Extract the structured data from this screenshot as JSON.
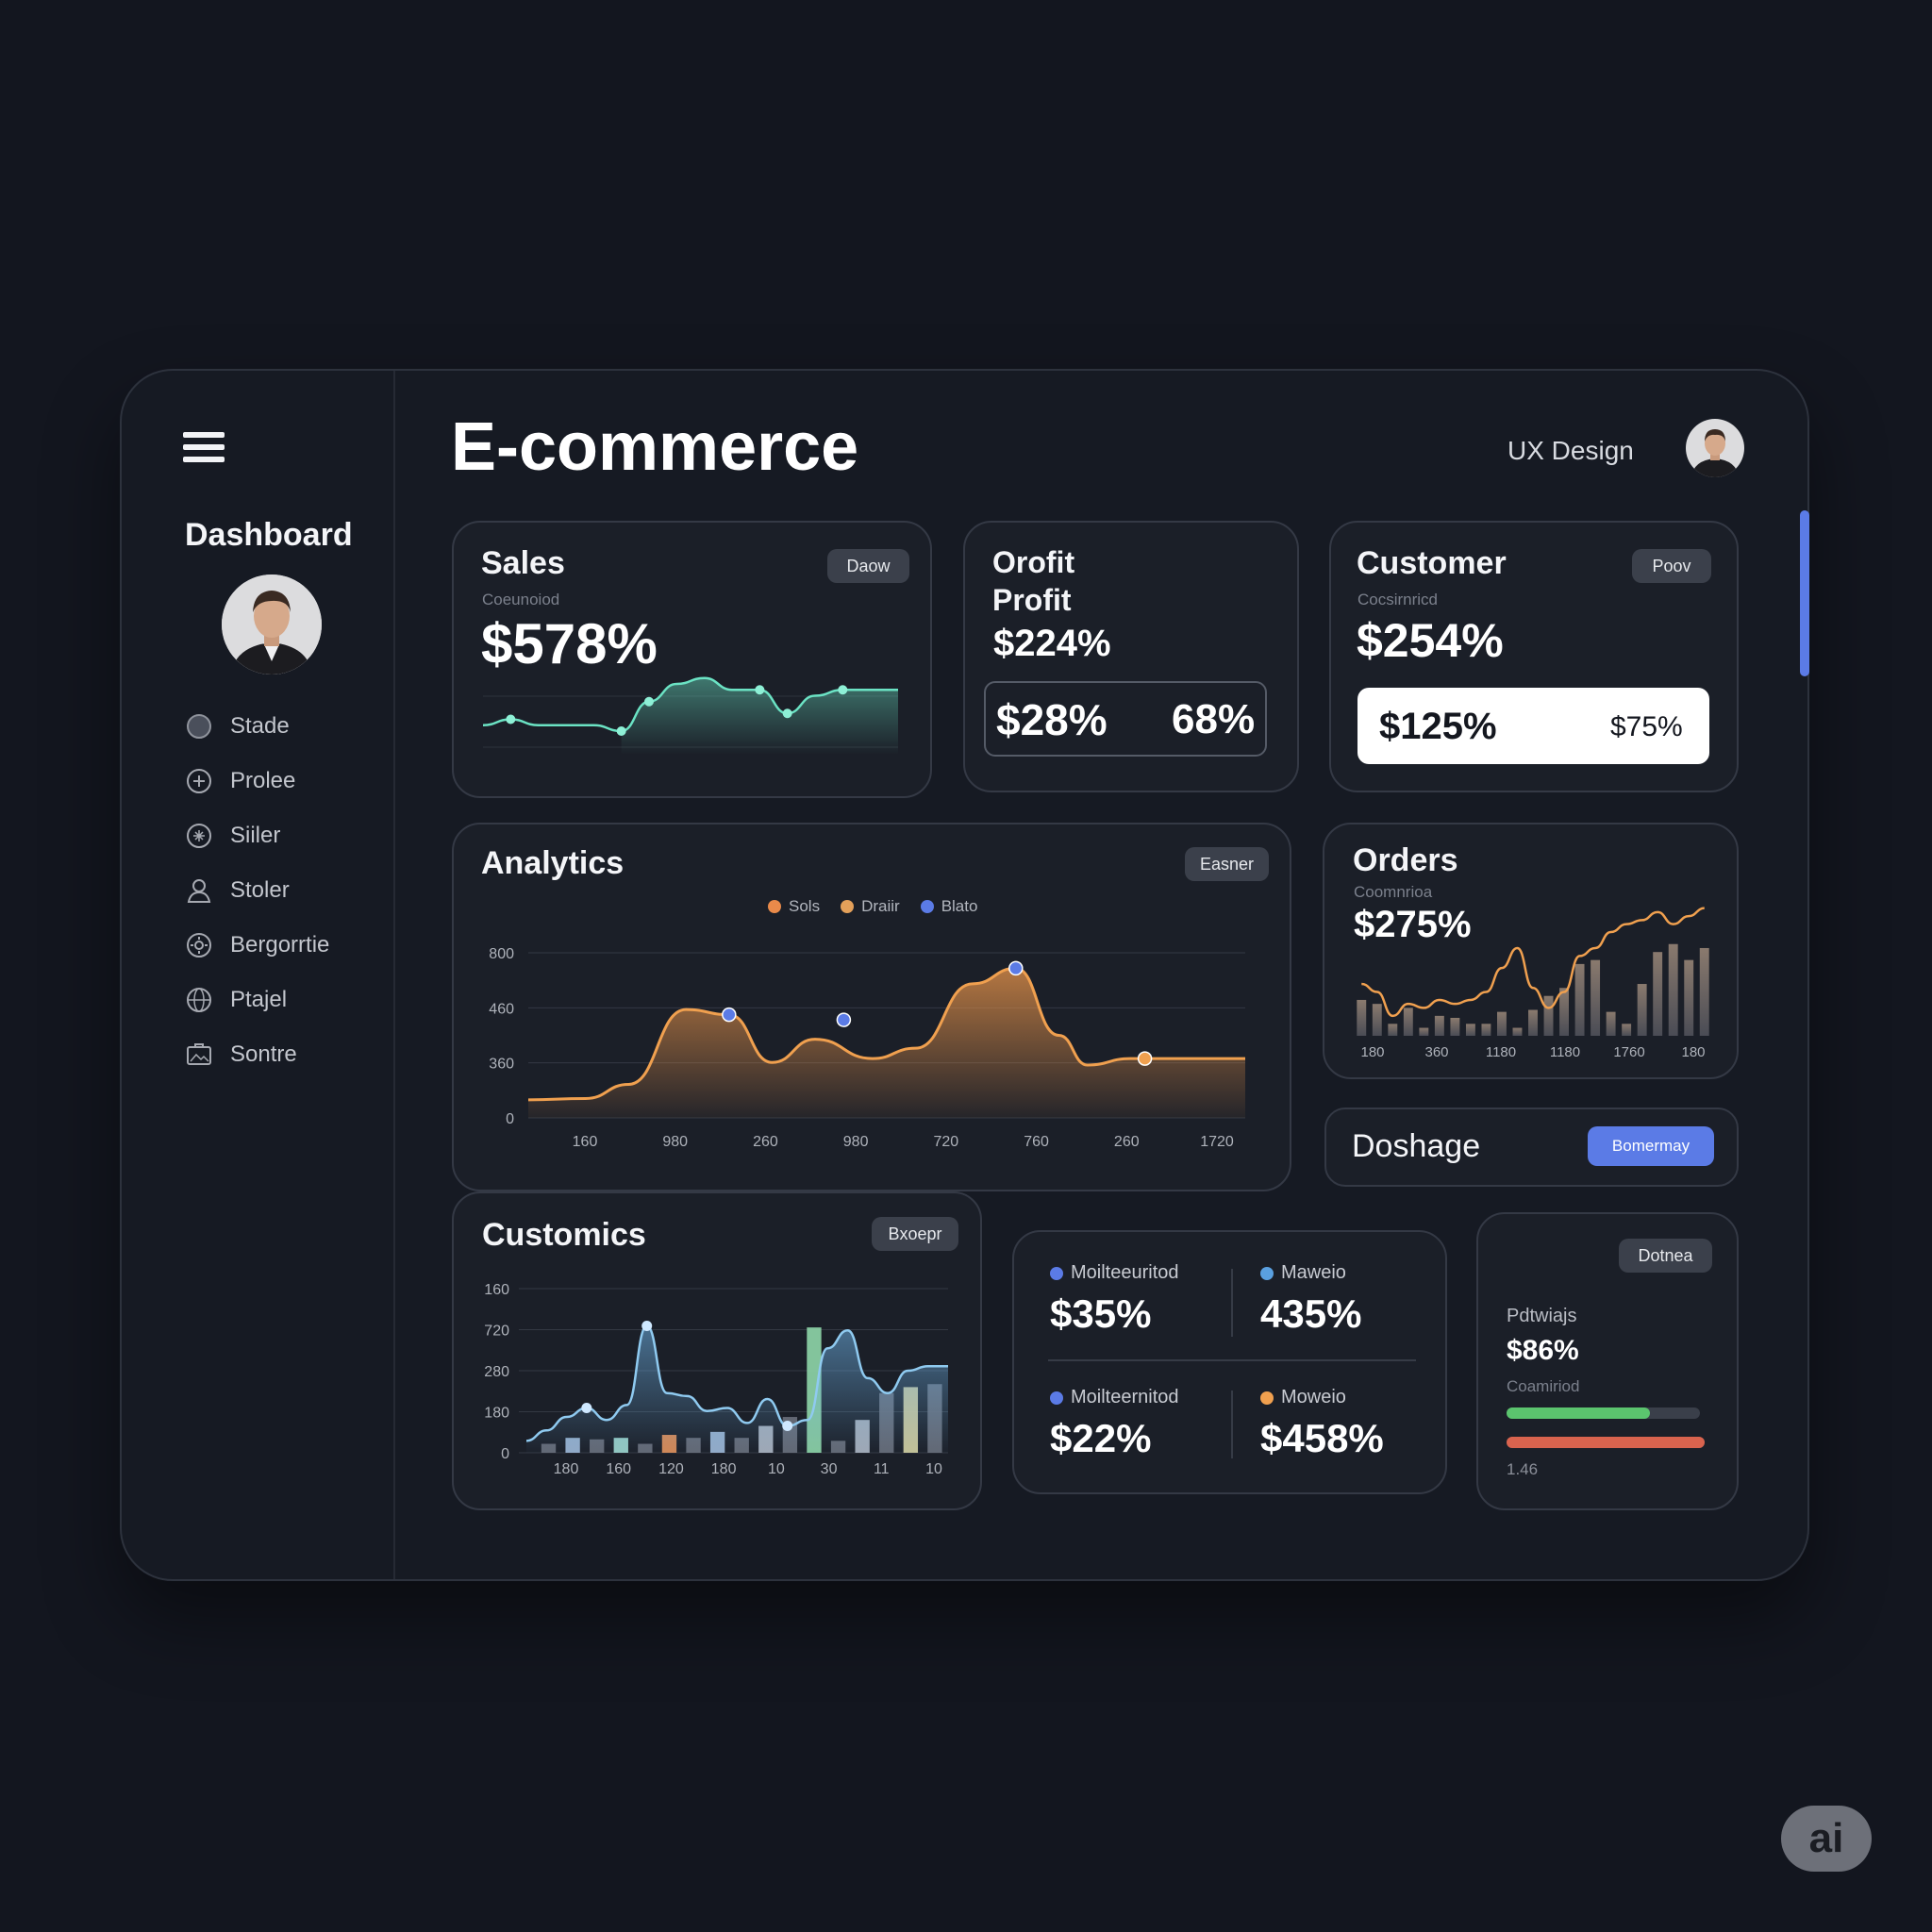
{
  "header": {
    "title": "E-commerce",
    "user_label": "UX Design"
  },
  "sidebar": {
    "title": "Dashboard",
    "items": [
      {
        "label": "Stade",
        "icon": "circle-icon"
      },
      {
        "label": "Prolee",
        "icon": "plus-circle-icon"
      },
      {
        "label": "Siiler",
        "icon": "sparkle-circle-icon"
      },
      {
        "label": "Stoler",
        "icon": "user-icon"
      },
      {
        "label": "Bergorrtie",
        "icon": "gear-circle-icon"
      },
      {
        "label": "Ptajel",
        "icon": "globe-icon"
      },
      {
        "label": "Sontre",
        "icon": "image-icon"
      }
    ]
  },
  "sales": {
    "title": "Sales",
    "badge": "Daow",
    "subtitle": "Coeunoiod",
    "value": "$578%",
    "chart_data": {
      "type": "line",
      "values": [
        5,
        6,
        5,
        5,
        5,
        4,
        9,
        12,
        13,
        11,
        11,
        7,
        10,
        11,
        11,
        11
      ],
      "ylim": [
        0,
        16
      ]
    }
  },
  "profit": {
    "title_line1": "Orofit",
    "title_line2": "Profit",
    "value": "$224%",
    "box_left": "$28%",
    "box_right": "68%"
  },
  "customer": {
    "title": "Customer",
    "badge": "Poov",
    "subtitle": "Cocsirnricd",
    "value": "$254%",
    "box_left": "$125%",
    "box_right": "$75%"
  },
  "analytics": {
    "title": "Analytics",
    "badge": "Easner",
    "legend": [
      {
        "name": "Sols",
        "color": "#e98a4a"
      },
      {
        "name": "Draiir",
        "color": "#e3a05a"
      },
      {
        "name": "Blato",
        "color": "#5b7be6"
      }
    ],
    "chart_data": {
      "type": "area",
      "y_ticks": [
        "0",
        "360",
        "460",
        "800"
      ],
      "x_ticks": [
        "160",
        "980",
        "260",
        "980",
        "720",
        "760",
        "260",
        "1720"
      ],
      "x": [
        0,
        8,
        14,
        22,
        28,
        34,
        40,
        48,
        54,
        62,
        68,
        74,
        78,
        84,
        90,
        100
      ],
      "y": [
        70,
        75,
        130,
        420,
        400,
        215,
        305,
        230,
        270,
        520,
        580,
        320,
        205,
        230,
        230,
        230
      ],
      "ylim": [
        0,
        640
      ],
      "highlight_points": [
        {
          "x": 28,
          "y": 400,
          "color": "#5b7be6"
        },
        {
          "x": 44,
          "y": 380,
          "color": "#5b7be6"
        },
        {
          "x": 68,
          "y": 580,
          "color": "#5b7be6"
        },
        {
          "x": 86,
          "y": 230,
          "color": "#f0a04f"
        }
      ]
    }
  },
  "orders": {
    "title": "Orders",
    "subtitle": "Coomnrioa",
    "value": "$275%",
    "chart_data": {
      "type": "bar",
      "values": [
        18,
        16,
        6,
        14,
        4,
        10,
        9,
        6,
        6,
        12,
        4,
        13,
        20,
        24,
        36,
        38,
        12,
        6,
        26,
        42,
        46,
        38,
        44
      ],
      "line": [
        26,
        22,
        10,
        16,
        14,
        18,
        16,
        18,
        22,
        34,
        44,
        24,
        14,
        22,
        40,
        44,
        52,
        56,
        58,
        62,
        56,
        60,
        64
      ],
      "x_ticks": [
        "180",
        "360",
        "1180",
        "1180",
        "1760",
        "180"
      ],
      "ylim": [
        0,
        70
      ]
    }
  },
  "doshage": {
    "title": "Doshage",
    "button": "Bomermay"
  },
  "customics": {
    "title": "Customics",
    "badge": "Bxoepr",
    "chart_data": {
      "type": "area",
      "y_ticks": [
        "0",
        "180",
        "280",
        "720",
        "160"
      ],
      "x_ticks": [
        "180",
        "160",
        "120",
        "180",
        "10",
        "30",
        "11",
        "10"
      ],
      "line": [
        8,
        15,
        24,
        30,
        22,
        32,
        85,
        40,
        38,
        28,
        30,
        20,
        36,
        18,
        22,
        70,
        82,
        50,
        40,
        55,
        58,
        58
      ],
      "bars": [
        6,
        10,
        9,
        10,
        6,
        12,
        10,
        14,
        10,
        18,
        24,
        84,
        8,
        22,
        40,
        44,
        46
      ],
      "ylim": [
        0,
        110
      ]
    }
  },
  "stats": [
    {
      "label": "Moilteeuritod",
      "value": "$35%",
      "color": "#5b7be6"
    },
    {
      "label": "Maweio",
      "value": "435%",
      "color": "#5aa0e0"
    },
    {
      "label": "Moilteernitod",
      "value": "$22%",
      "color": "#5b7be6"
    },
    {
      "label": "Moweio",
      "value": "$458%",
      "color": "#f0a04f"
    }
  ],
  "progress": {
    "badge": "Dotnea",
    "label": "Pdtwiajs",
    "value": "$86%",
    "subtitle": "Coamiriod",
    "footer": "1.46",
    "green_fraction": 0.74,
    "red_fraction": 1.0
  },
  "watermark": "ai",
  "colors": {
    "accent": "#5b7be6",
    "orange": "#f0a04f",
    "teal": "#6be3c4",
    "green": "#5bc46e",
    "red": "#d9634e"
  }
}
